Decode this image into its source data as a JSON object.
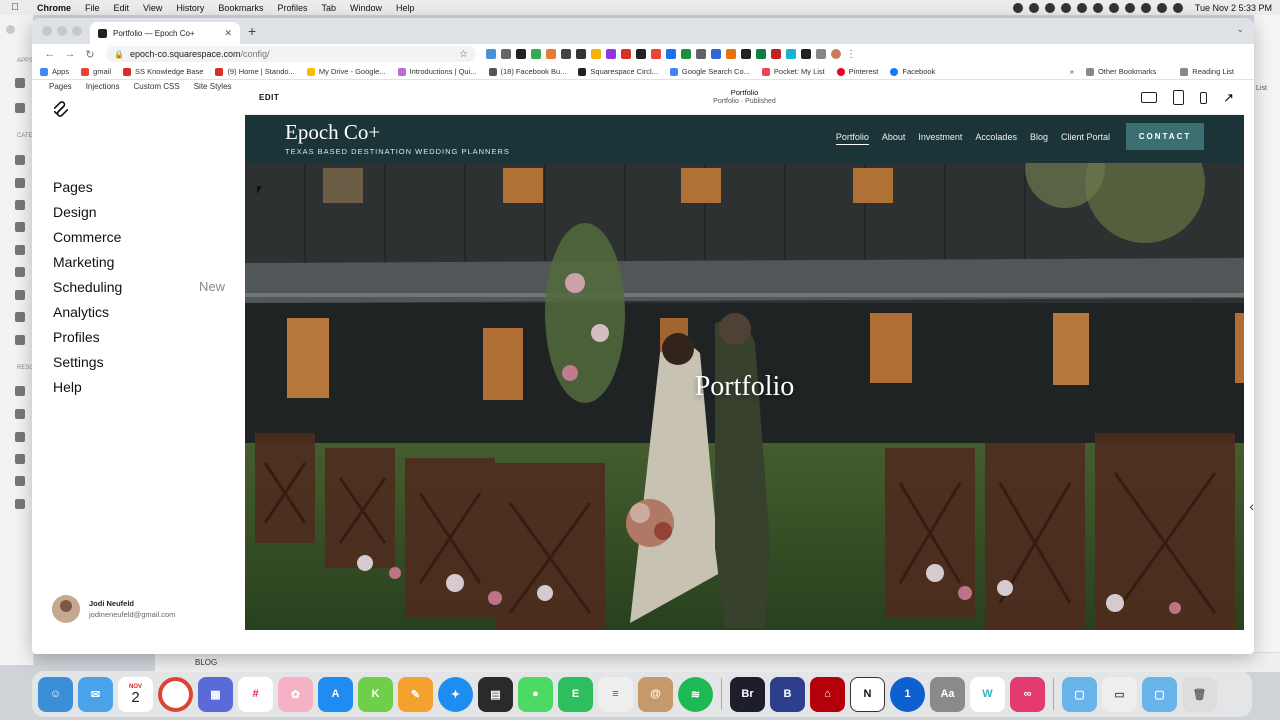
{
  "menubar": {
    "items": [
      "Chrome",
      "File",
      "Edit",
      "View",
      "History",
      "Bookmarks",
      "Profiles",
      "Tab",
      "Window",
      "Help"
    ],
    "clock": "Tue Nov 2  5:33 PM"
  },
  "chrome": {
    "tab_title": "Portfolio — Epoch Co+",
    "url_host": "epoch-co.squarespace.com",
    "url_path": "/config/",
    "bookmarks": [
      "Apps",
      "gmail",
      "SS Knowledge Base",
      "(9) Home | Stando...",
      "My Drive - Google...",
      "Introductions | Qui...",
      "(18) Facebook Bu...",
      "Squarespace Circl...",
      "Google Search Co...",
      "Pocket: My List",
      "Pinterest",
      "Facebook"
    ],
    "bookmarks_more": "»",
    "other_bookmarks": "Other Bookmarks",
    "reading_list": "Reading List"
  },
  "background": {
    "left_labels": [
      "APPS",
      "CATE",
      "RESO"
    ],
    "right_label": "List",
    "bottom_label": "BLOG"
  },
  "squarespace": {
    "topnav": [
      "Pages",
      "Injections",
      "Custom CSS",
      "Site Styles",
      "+"
    ],
    "menu": [
      "Pages",
      "Design",
      "Commerce",
      "Marketing",
      "Scheduling",
      "Analytics",
      "Profiles",
      "Settings",
      "Help"
    ],
    "scheduling_badge": "New",
    "user_name": "Jodi Neufeld",
    "user_email": "jodineneufeld@gmail.com"
  },
  "preview": {
    "edit_label": "EDIT",
    "page_title": "Portfolio",
    "page_status": "Portfolio · Published"
  },
  "site": {
    "brand": "Epoch Co+",
    "tagline": "TEXAS BASED DESTINATION WEDDING PLANNERS",
    "nav": [
      "Portfolio",
      "About",
      "Investment",
      "Accolades",
      "Blog",
      "Client Portal"
    ],
    "cta": "CONTACT",
    "hero_title": "Portfolio"
  },
  "dock": {
    "calendar_month": "NOV",
    "calendar_day": "2",
    "bridge_label": "Br",
    "notion_label": "N",
    "webflow_label": "W"
  },
  "colors": {
    "site_nav_bg": "#1a3437",
    "cta_bg": "#3c6f71"
  }
}
